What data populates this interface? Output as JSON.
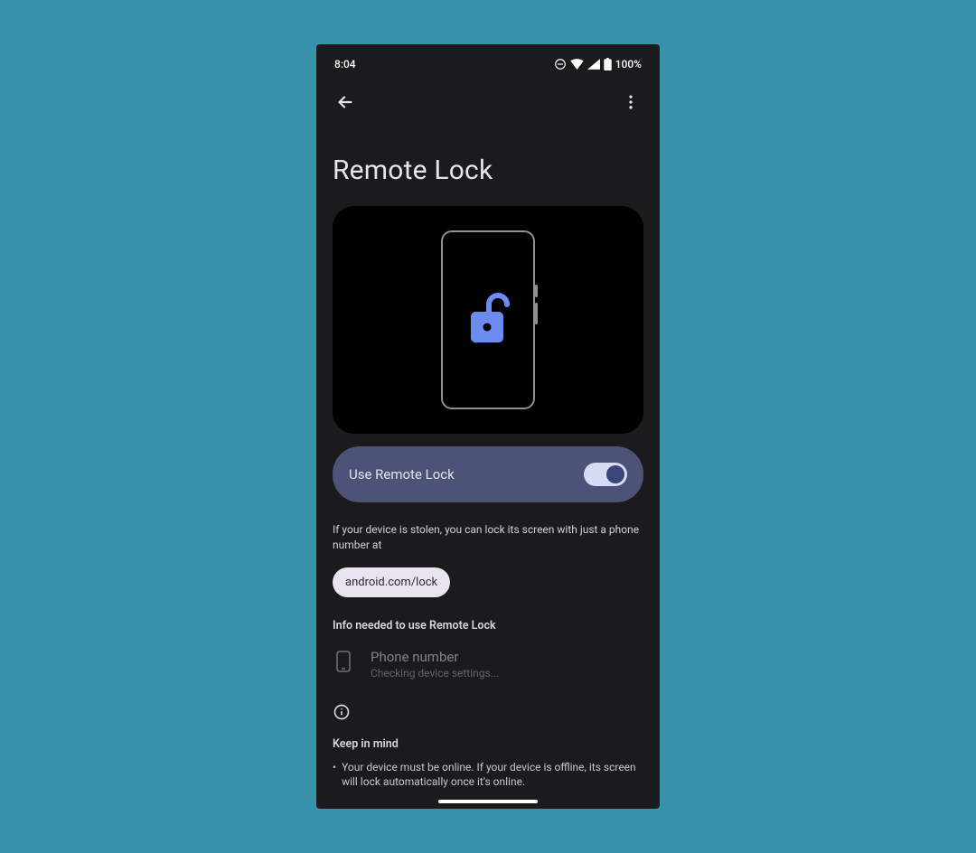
{
  "status_bar": {
    "time": "8:04",
    "battery": "100%"
  },
  "page": {
    "title": "Remote Lock"
  },
  "toggle": {
    "label": "Use Remote Lock",
    "on": true
  },
  "description": "If your device is stolen, you can lock its screen with just a phone number at",
  "link": "android.com/lock",
  "info_section": {
    "heading": "Info needed to use Remote Lock",
    "item": {
      "title": "Phone number",
      "subtitle": "Checking device settings..."
    }
  },
  "keep_in_mind": {
    "heading": "Keep in mind",
    "bullets": [
      "Your device must be online. If your device is offline, its screen will lock automatically once it's online."
    ]
  }
}
